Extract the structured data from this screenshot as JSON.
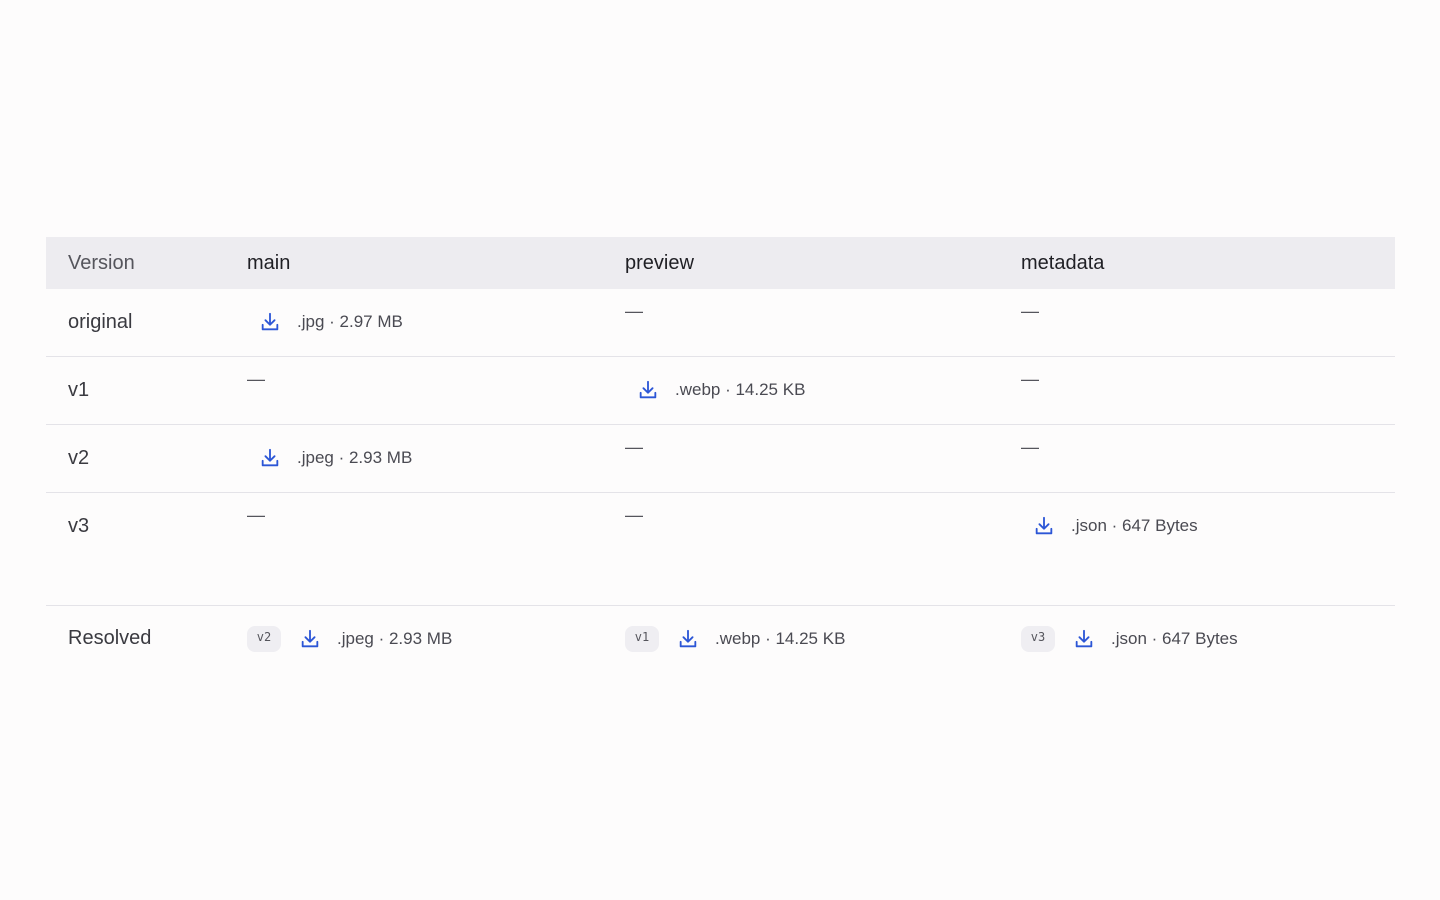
{
  "colors": {
    "accent": "#2c56d6",
    "header_bg": "#edecf0",
    "badge_bg": "#efeef2",
    "divider": "#e4e3e8"
  },
  "columns": {
    "version": "Version",
    "main": "main",
    "preview": "preview",
    "metadata": "metadata"
  },
  "empty_marker": "—",
  "rows": [
    {
      "version": "original",
      "main": ".jpg · 2.97 MB",
      "preview": null,
      "metadata": null
    },
    {
      "version": "v1",
      "main": null,
      "preview": ".webp · 14.25 KB",
      "metadata": null
    },
    {
      "version": "v2",
      "main": ".jpeg · 2.93 MB",
      "preview": null,
      "metadata": null
    },
    {
      "version": "v3",
      "main": null,
      "preview": null,
      "metadata": ".json · 647 Bytes"
    }
  ],
  "resolved": {
    "label": "Resolved",
    "main": {
      "badge": "v2",
      "file": ".jpeg · 2.93 MB"
    },
    "preview": {
      "badge": "v1",
      "file": ".webp · 14.25 KB"
    },
    "metadata": {
      "badge": "v3",
      "file": ".json · 647 Bytes"
    }
  },
  "icons": {
    "download": "download-icon"
  }
}
